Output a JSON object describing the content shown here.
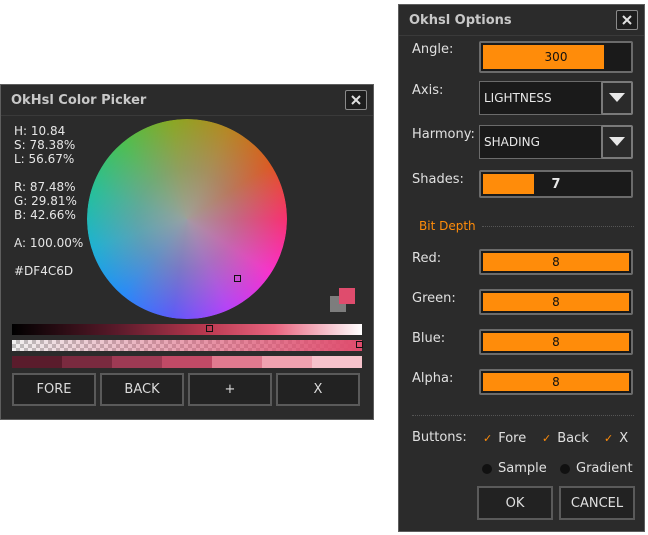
{
  "picker": {
    "title": "OkHsl Color Picker",
    "readouts": {
      "h": "H: 10.84",
      "s": "S: 78.38%",
      "l": "L: 56.67%",
      "r": "R: 87.48%",
      "g": "G: 29.81%",
      "b": "B: 42.66%",
      "a": "A: 100.00%",
      "hex": "#DF4C6D"
    },
    "fore_color": "#df4c6d",
    "back_color": "#7d7d7d",
    "shade_colors": [
      "#5a1c2c",
      "#7a2a3f",
      "#9e3a54",
      "#c04a66",
      "#e07a8f",
      "#f0a2b0",
      "#f6c2cb"
    ],
    "buttons": {
      "fore": "FORE",
      "back": "BACK",
      "add": "+",
      "clear": "X"
    }
  },
  "options": {
    "title": "Okhsl Options",
    "angle": {
      "label": "Angle:",
      "value": "300",
      "fraction": 0.83
    },
    "axis": {
      "label": "Axis:",
      "selected": "LIGHTNESS"
    },
    "harmony": {
      "label": "Harmony:",
      "selected": "SHADING"
    },
    "shades": {
      "label": "Shades:",
      "value": "7",
      "fraction": 0.35
    },
    "bit_depth": {
      "title": "Bit Depth",
      "red": {
        "label": "Red:",
        "value": "8"
      },
      "green": {
        "label": "Green:",
        "value": "8"
      },
      "blue": {
        "label": "Blue:",
        "value": "8"
      },
      "alpha": {
        "label": "Alpha:",
        "value": "8"
      }
    },
    "buttons": {
      "label": "Buttons:",
      "fore": "Fore",
      "back": "Back",
      "x": "X",
      "sample": "Sample",
      "gradient": "Gradient"
    },
    "ok": "OK",
    "cancel": "CANCEL"
  },
  "colors": {
    "accent": "#ff8c0a",
    "panel": "#2b2b2b"
  }
}
